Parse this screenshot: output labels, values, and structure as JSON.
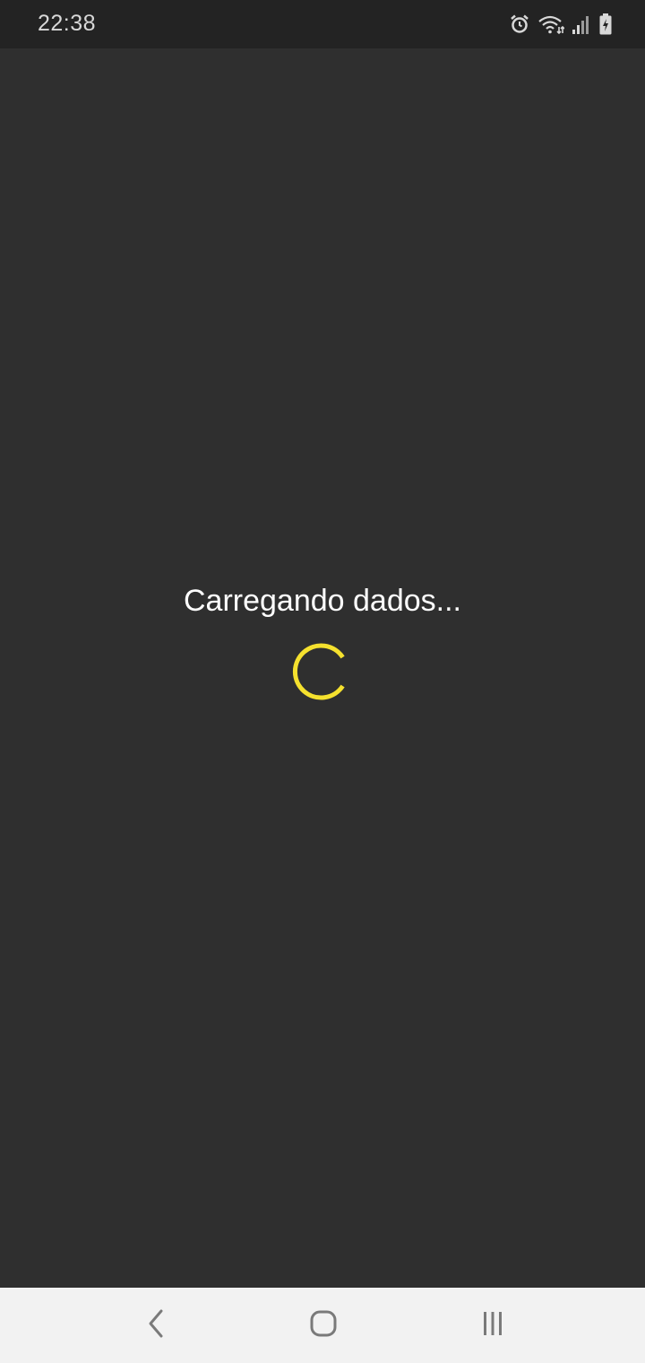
{
  "status_bar": {
    "time": "22:38",
    "icons": [
      "alarm-icon",
      "wifi-icon",
      "signal-icon",
      "battery-charging-icon"
    ]
  },
  "main": {
    "loading_text": "Carregando dados...",
    "spinner_color": "#f5e12e"
  },
  "nav_bar": {
    "buttons": [
      "back-icon",
      "home-icon",
      "recents-icon"
    ]
  },
  "colors": {
    "background": "#2f2f2f",
    "status_bar": "#232323",
    "nav_bar": "#f2f2f2",
    "accent": "#f5e12e"
  }
}
